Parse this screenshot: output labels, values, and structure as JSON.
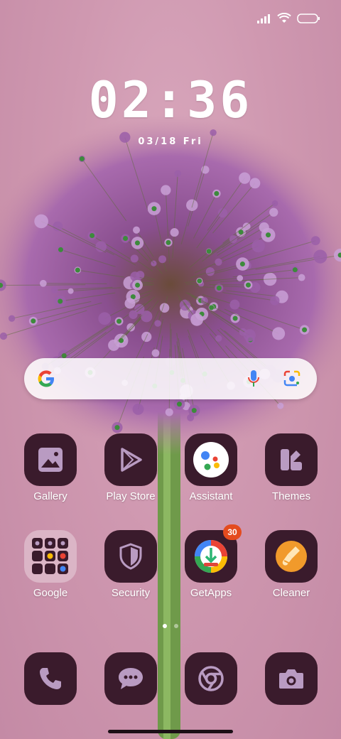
{
  "status_bar": {
    "icons": [
      "signal-icon",
      "wifi-icon",
      "battery-icon"
    ]
  },
  "lock": {
    "time": "02:36",
    "date": "03/18 Fri"
  },
  "search_bar": {
    "icons": [
      "google-g-icon",
      "microphone-icon",
      "google-lens-icon"
    ]
  },
  "apps_row1": [
    {
      "label": "Gallery",
      "icon": "gallery-icon"
    },
    {
      "label": "Play Store",
      "icon": "play-store-icon"
    },
    {
      "label": "Assistant",
      "icon": "assistant-icon"
    },
    {
      "label": "Themes",
      "icon": "themes-icon"
    }
  ],
  "apps_row2": [
    {
      "label": "Google",
      "icon": "google-folder-icon"
    },
    {
      "label": "Security",
      "icon": "security-icon"
    },
    {
      "label": "GetApps",
      "icon": "getapps-icon",
      "badge": "30"
    },
    {
      "label": "Cleaner",
      "icon": "cleaner-icon"
    }
  ],
  "dock": [
    {
      "icon": "phone-icon"
    },
    {
      "icon": "messages-icon"
    },
    {
      "icon": "chrome-icon"
    },
    {
      "icon": "camera-icon"
    }
  ],
  "page_indicator": {
    "pages": 2,
    "current": 1
  },
  "colors": {
    "tile": "#3a1b2c",
    "glyph": "#b99bc2",
    "badge": "#e44b1e",
    "wallpaper": "#cf98b0"
  }
}
